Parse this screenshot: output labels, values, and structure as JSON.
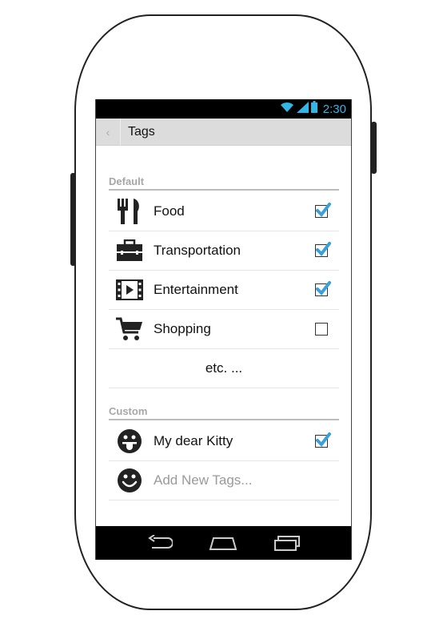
{
  "status_bar": {
    "time": "2:30"
  },
  "action_bar": {
    "title": "Tags"
  },
  "sections": {
    "default_header": "Default",
    "custom_header": "Custom"
  },
  "default_tags": [
    {
      "label": "Food",
      "icon": "fork-knife-icon",
      "checked": true
    },
    {
      "label": "Transportation",
      "icon": "briefcase-icon",
      "checked": true
    },
    {
      "label": "Entertainment",
      "icon": "film-icon",
      "checked": true
    },
    {
      "label": "Shopping",
      "icon": "shopping-cart-icon",
      "checked": false
    }
  ],
  "etc_label": "etc. ...",
  "custom_tags": [
    {
      "label": "My dear Kitty",
      "icon": "tongue-face-icon",
      "checked": true
    }
  ],
  "add_new": {
    "placeholder": "Add New Tags...",
    "icon": "smiley-icon"
  },
  "colors": {
    "accent": "#33b5e5",
    "checkmark": "#3aa0d8"
  }
}
